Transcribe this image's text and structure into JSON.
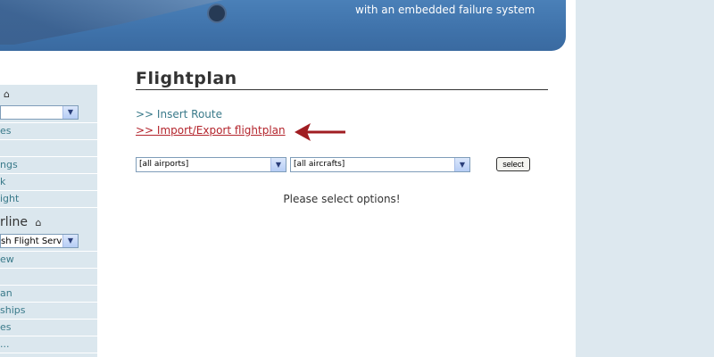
{
  "banner": {
    "tagline": "with an embedded failure system"
  },
  "sidebar": {
    "select_a_value": "",
    "links_a": [
      "es",
      "",
      "ngs",
      "k",
      "ight"
    ],
    "section2_title": "rline",
    "select_b_value": "sh Flight Servic",
    "links_b": [
      "ew",
      "",
      "an",
      "ships",
      "es",
      "..."
    ]
  },
  "main": {
    "title": "Flightplan",
    "link_insert_route": ">> Insert Route",
    "link_import_export": ">> Import/Export flightplan",
    "filter_airports": "[all airports]",
    "filter_aircrafts": "[all aircrafts]",
    "select_button": "select",
    "message": "Please select options!"
  },
  "colors": {
    "banner": "#3f72aa",
    "sidebar_bg": "#dbe7ee",
    "link": "#3a7a8a",
    "active_link": "#b3242c",
    "annotation_arrow": "#a01d22"
  },
  "icons": [
    "home-icon",
    "chevron-down-icon",
    "annotation-arrow"
  ]
}
